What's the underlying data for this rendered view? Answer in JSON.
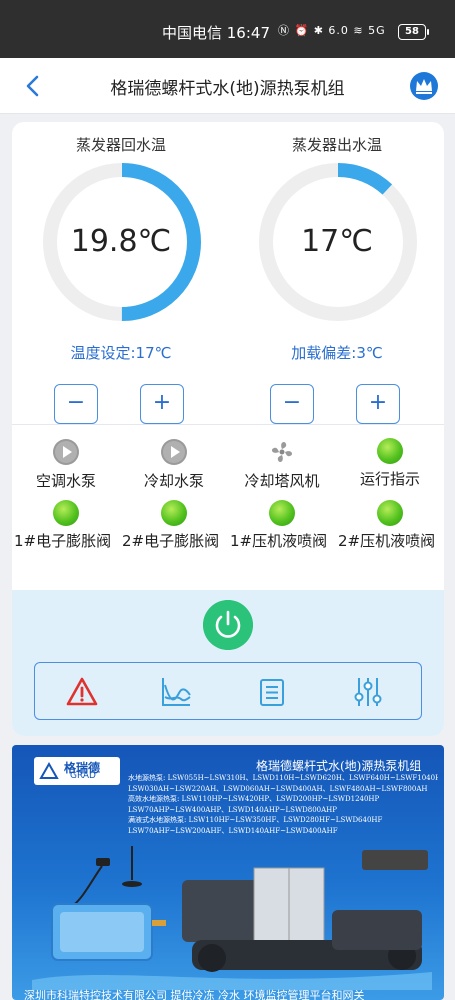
{
  "status_bar": {
    "carrier_time": "中国电信 16:47",
    "icons_text": "Ⓝ ⏰ ✱ 6.0 ≋ 5G",
    "battery": "58",
    "icons": [
      "nfc-icon",
      "alarm-icon",
      "bluetooth-icon",
      "speed-icon",
      "wifi-icon",
      "signal-icon"
    ]
  },
  "header": {
    "title": "格瑞德螺杆式水(地)源热泵机组",
    "back_icon": "chevron-left-icon",
    "vip_icon": "crown-icon"
  },
  "gauges": [
    {
      "label": "蒸发器回水温",
      "value": "19.8℃",
      "fill": 0.5,
      "setting": "温度设定:17℃",
      "minus": "−",
      "plus": "+"
    },
    {
      "label": "蒸发器出水温",
      "value": "17℃",
      "fill": 0.12,
      "setting": "加载偏差:3℃",
      "minus": "−",
      "plus": "+"
    }
  ],
  "status_items": [
    {
      "label": "空调水泵",
      "icon": "play-icon",
      "state": "off"
    },
    {
      "label": "冷却水泵",
      "icon": "play-icon",
      "state": "off"
    },
    {
      "label": "冷却塔风机",
      "icon": "fan-icon",
      "state": "off"
    },
    {
      "label": "运行指示",
      "icon": "green-light-icon",
      "state": "on"
    },
    {
      "label": "1#电子膨胀阀",
      "icon": "green-light-icon",
      "state": "on"
    },
    {
      "label": "2#电子膨胀阀",
      "icon": "green-light-icon",
      "state": "on"
    },
    {
      "label": "1#压机液喷阀",
      "icon": "green-light-icon",
      "state": "on"
    },
    {
      "label": "2#压机液喷阀",
      "icon": "green-light-icon",
      "state": "on"
    }
  ],
  "controls": {
    "power_icon": "power-icon",
    "tools": [
      "alarm-warning-icon",
      "curve-chart-icon",
      "list-icon",
      "settings-sliders-icon"
    ]
  },
  "ad": {
    "logo_cn": "格瑞德",
    "logo_en": "GRAD",
    "title": "格瑞德螺杆式水(地)源热泵机组",
    "lines": [
      "水地源热泵: LSW055H~LSW310H、LSWD110H~LSWD620H、LSWF640H~LSWF1040H",
      "LSW030AH~LSW220AH、LSWD060AH~LSWD400AH、LSWF480AH~LSWF800AH",
      "高效水地源热泵: LSW110HP~LSW420HP、LSWD200HP~LSWD1240HP",
      "LSW70AHP~LSW400AHP、LSWD140AHP~LSWD800AHP",
      "满液式水地源热泵: LSW110HF~LSW350HF、LSWD280HF~LSWD640HF",
      "LSW70AHF~LSW200AHF、LSWD140AHF~LSWD400AHF"
    ],
    "footer": "深圳市科瑞特控技术有限公司   提供冷冻 冷水 环境监控管理平台和网关"
  },
  "colors": {
    "accent": "#2a6fd0",
    "gauge_track": "#eeeeee",
    "gauge_fill": "#3aa8ea",
    "power": "#2bc27a",
    "alarm_red": "#e0322d",
    "panel_bg": "#dff0fb"
  }
}
